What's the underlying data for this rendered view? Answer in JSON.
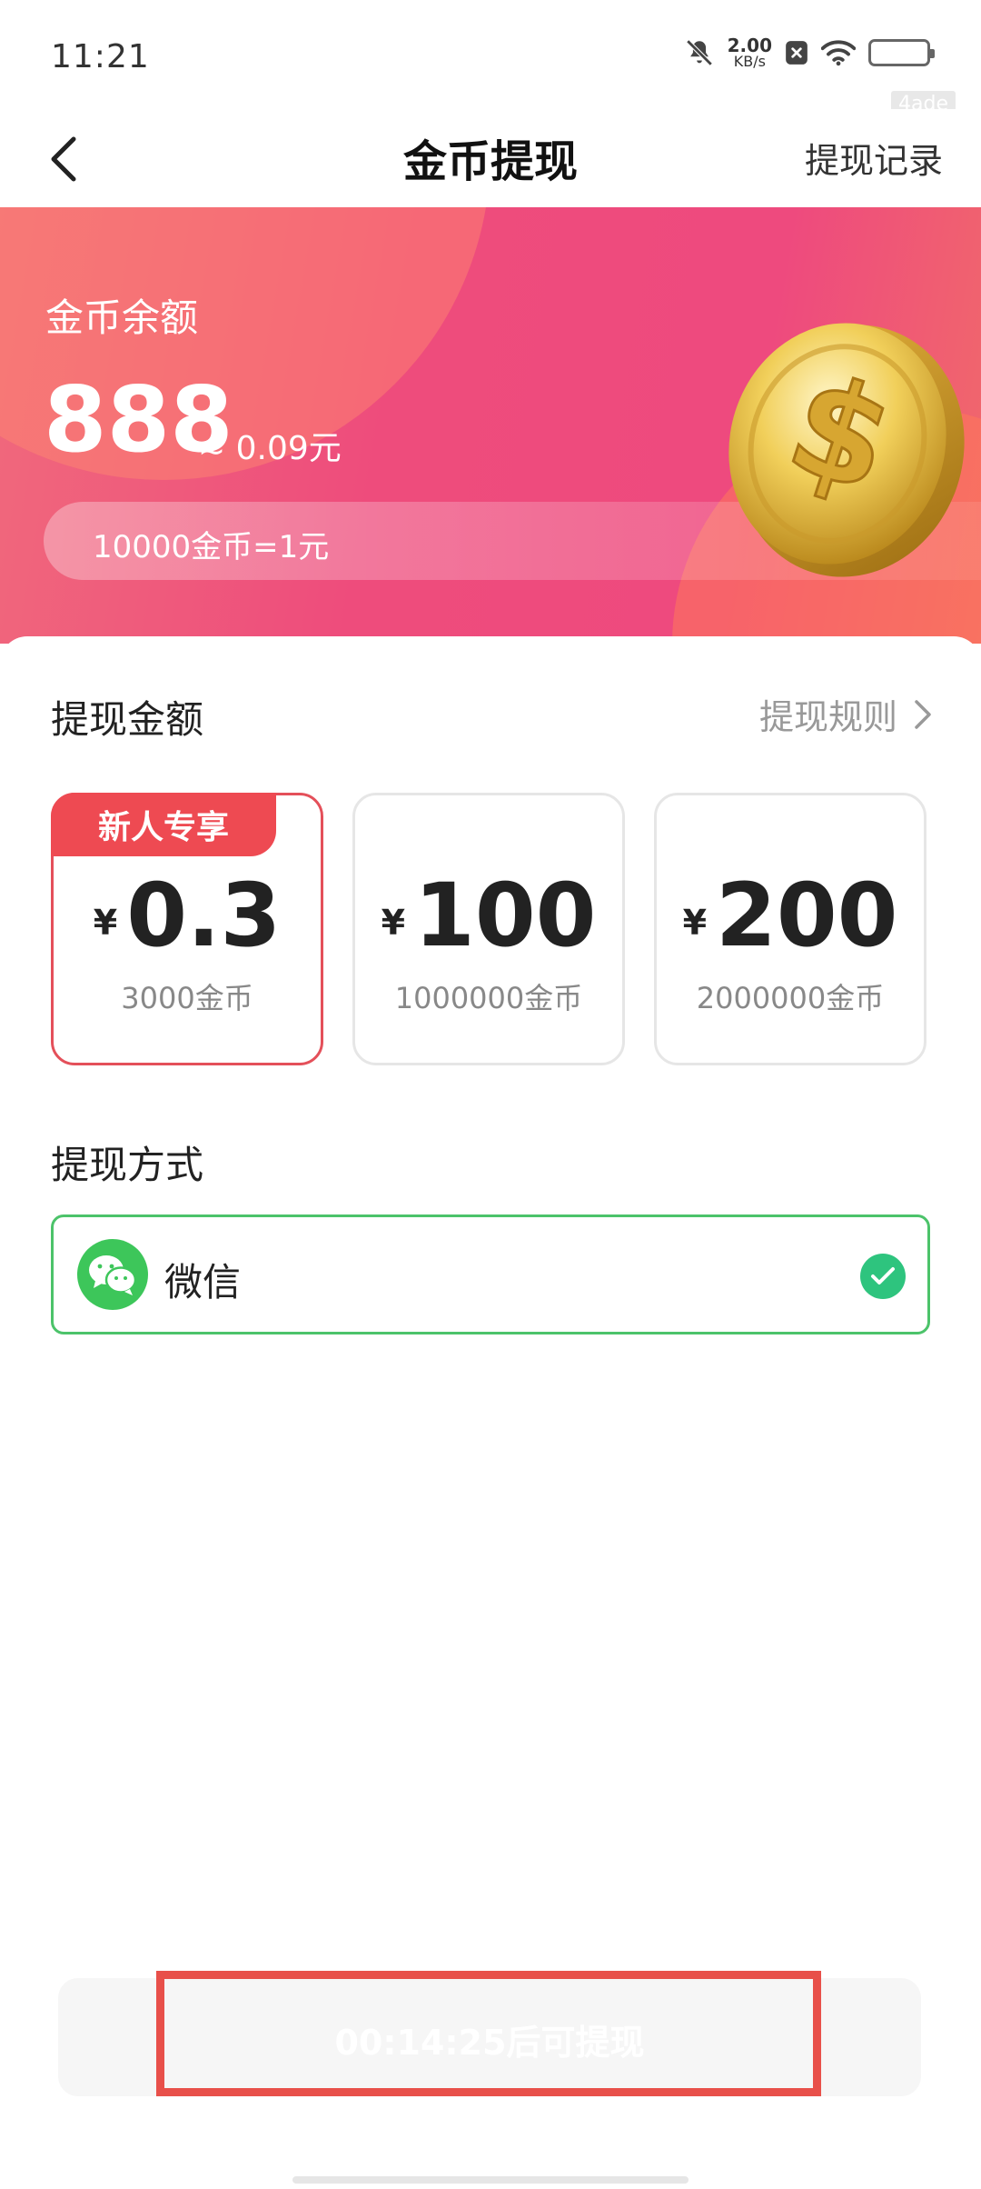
{
  "status_bar": {
    "time": "11:21",
    "net_speed_value": "2.00",
    "net_speed_unit": "KB/s",
    "corner_tag": "4ade",
    "icons": [
      "mute-bell-icon",
      "close-box-icon",
      "wifi-icon",
      "battery-icon"
    ]
  },
  "nav": {
    "back_icon": "chevron-left-icon",
    "title": "金币提现",
    "right_action": "提现记录"
  },
  "balance": {
    "label": "金币余额",
    "value": "888",
    "approx": "≈ 0.09元",
    "rate": "10000金币=1元",
    "coin_image": "gold-coin-dollar"
  },
  "amounts": {
    "title": "提现金额",
    "rules_label": "提现规则",
    "currency_symbol": "¥",
    "options": [
      {
        "badge": "新人专享",
        "value": "0.3",
        "coins": "3000金币",
        "selected": true
      },
      {
        "badge": "",
        "value": "100",
        "coins": "1000000金币",
        "selected": false
      },
      {
        "badge": "",
        "value": "200",
        "coins": "2000000金币",
        "selected": false
      }
    ]
  },
  "method": {
    "title": "提现方式",
    "option_label": "微信",
    "option_icon": "wechat-icon",
    "checked_icon": "check-circle-icon"
  },
  "submit": {
    "label": "00:14:25后可提现"
  },
  "colors": {
    "accent_red": "#ee4a52",
    "banner_pink": "#ee4c7c",
    "wechat_green": "#3dc65a",
    "check_green": "#2ec47e",
    "highlight_frame": "#e8504a"
  }
}
